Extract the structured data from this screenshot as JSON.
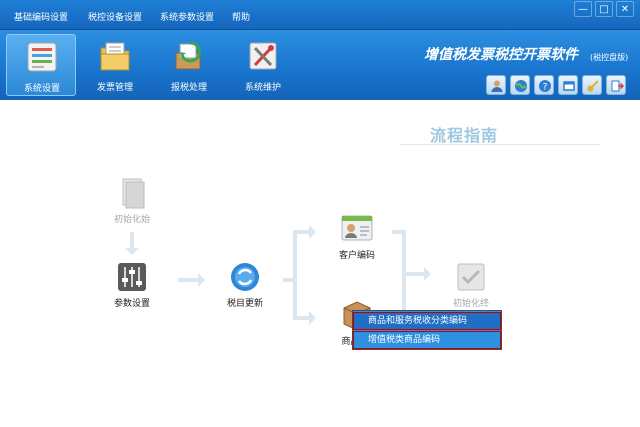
{
  "menu": {
    "items": [
      "基础编码设置",
      "税控设备设置",
      "系统参数设置",
      "帮助"
    ],
    "window_controls": [
      "—",
      "□",
      "✕"
    ]
  },
  "toolbar": {
    "tools": [
      {
        "label": "系统设置",
        "icon": "system-settings-icon",
        "active": true
      },
      {
        "label": "发票管理",
        "icon": "invoice-folder-icon",
        "active": false
      },
      {
        "label": "报税处理",
        "icon": "tax-report-icon",
        "active": false
      },
      {
        "label": "系统维护",
        "icon": "maintenance-tools-icon",
        "active": false
      }
    ],
    "app_title": "增值税发票税控开票软件",
    "app_subtitle": "(税控盘版)",
    "system_buttons": [
      "user-icon",
      "globe-icon",
      "help-icon",
      "window-icon",
      "key-icon",
      "exit-icon"
    ]
  },
  "flow": {
    "title": "流程指南",
    "nodes": {
      "init": "初始化始",
      "params": "参数设置",
      "tax_update": "税目更新",
      "client_code": "客户编码",
      "product_code": "商品编",
      "init_end": "初始化终"
    }
  },
  "context_menu": {
    "items": [
      "商品和服务税收分类编码",
      "增值税类商品编码"
    ]
  },
  "colors": {
    "menubar": "#1f7fd6",
    "toolbar": "#1a76cf",
    "context_menu": "#2f8fe0",
    "highlight_border": "#c00000"
  }
}
